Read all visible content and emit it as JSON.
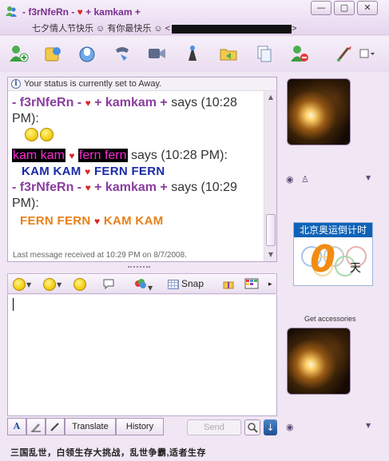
{
  "titlebar": {
    "contact_name": "- f3rNfeRn - ♥ + kamkam +",
    "personal_message": "七夕情人节快乐 ☺ 有你最快乐 ☺ <",
    "personal_message_end": ">",
    "buttons": {
      "minimize": "—",
      "maximize": "▢",
      "close": "✕"
    }
  },
  "toolbar": {
    "icons": [
      "invite-contact-icon",
      "send-files-icon",
      "voice-call-icon",
      "phone-icon",
      "video-icon",
      "activities-icon",
      "share-folder-icon",
      "copy-icon",
      "block-icon",
      "paint-icon",
      "menu-icon"
    ]
  },
  "status_notice": "Your status is currently set to Away.",
  "messages": [
    {
      "sender": "- f3rNfeRn - ♥ + kamkam +",
      "time": "says (10:28 PM):"
    },
    {
      "sender": "kam kam ♥ fern fern",
      "time": "says (10:28 PM):",
      "text": "KAM KAM ♥ FERN FERN"
    },
    {
      "sender": "- f3rNfeRn - ♥ + kamkam +",
      "time": "says (10:29 PM):",
      "text": "FERN FERN ♥ KAM KAM"
    }
  ],
  "msg1": {
    "a": "- f3rNfeRn - ",
    "heart": "♥",
    "b": " + kamkam + ",
    "says": "says (10:28 PM):"
  },
  "msg2": {
    "a": "kam kam",
    "heart": "♥",
    "b": "fern fern",
    "says": " says (10:28 PM):",
    "text_a": "KAM KAM ",
    "text_heart": "♥",
    "text_b": " FERN FERN"
  },
  "msg3": {
    "a": "- f3rNfeRn - ",
    "heart": "♥",
    "b": " + kamkam + ",
    "says": "says (10:29 PM):",
    "text_a": "FERN FERN ",
    "text_heart": "♥",
    "text_b": " KAM KAM"
  },
  "last_message": "Last message received at 10:29 PM on 8/7/2008.",
  "format_toolbar": {
    "snap_label": "Snap"
  },
  "bottom_tabs": {
    "font": "A",
    "translate": "Translate",
    "history": "History",
    "send": "Send"
  },
  "footer": "三国乱世，白领生存大挑战，乱世争霸,适者生存",
  "ad": {
    "title": "北京奥运倒计时",
    "value": "0",
    "unit": "天"
  },
  "get_accessories": "Get accessories",
  "colors": {
    "accent": "#8a3d9e",
    "blue_text": "#1a2aa8",
    "orange_text": "#e8801a",
    "ad_blue": "#0e62b7"
  }
}
